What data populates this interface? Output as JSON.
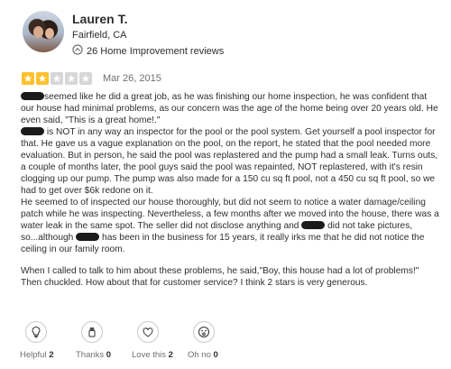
{
  "user": {
    "name": "Lauren T.",
    "location": "Fairfield, CA",
    "reviews_count": "26 Home Improvement reviews"
  },
  "review": {
    "rating": 2,
    "max_rating": 5,
    "date": "Mar 26, 2015",
    "p1": "seemed like he did a great job, as he was finishing our home inspection, he was confident that our house had minimal problems, as our concern was the age of the home being over 20 years old. He even said, \"This is a great home!.\"",
    "p2": "is NOT in any way an inspector for the pool or the pool system. Get yourself a pool inspector for that. He gave us a vague explanation on the pool, on the report, he stated that the pool needed more evaluation. But in person, he said the pool was replastered and the pump had a small leak. Turns outs, a couple of months later, the pool guys said the pool was repainted, NOT replastered, with it's resin clogging up our pump. The pump was also made for a 150 cu sq ft pool, not a 450 cu sq ft pool, so we had to get over $6k redone on it.",
    "p3a": "He seemed to of inspected our house thoroughly, but did not seem to notice a water damage/ceiling patch while he was inspecting. Nevertheless, a few months after we moved into the house, there was a water leak in the same spot. The seller did not disclose anything and",
    "p3b": "did not take pictures, so...although",
    "p3c": "has been in the business for 15 years, it really irks me that he did not notice the ceiling in our family room.",
    "p4": "When I called to talk to him about these problems, he said,\"Boy, this house had a lot of problems!\" Then chuckled. How about that for customer service? I think 2 stars is very generous."
  },
  "reactions": [
    {
      "label": "Helpful",
      "count": "2",
      "icon": "lightbulb-icon"
    },
    {
      "label": "Thanks",
      "count": "0",
      "icon": "thanks-hands-icon"
    },
    {
      "label": "Love this",
      "count": "2",
      "icon": "love-heart-icon"
    },
    {
      "label": "Oh no",
      "count": "0",
      "icon": "oh-no-face-icon"
    }
  ],
  "colors": {
    "star_on": "#ffc12d",
    "star_off": "#d7d7d9",
    "text": "#2d2e2f",
    "muted": "#6e7072"
  }
}
